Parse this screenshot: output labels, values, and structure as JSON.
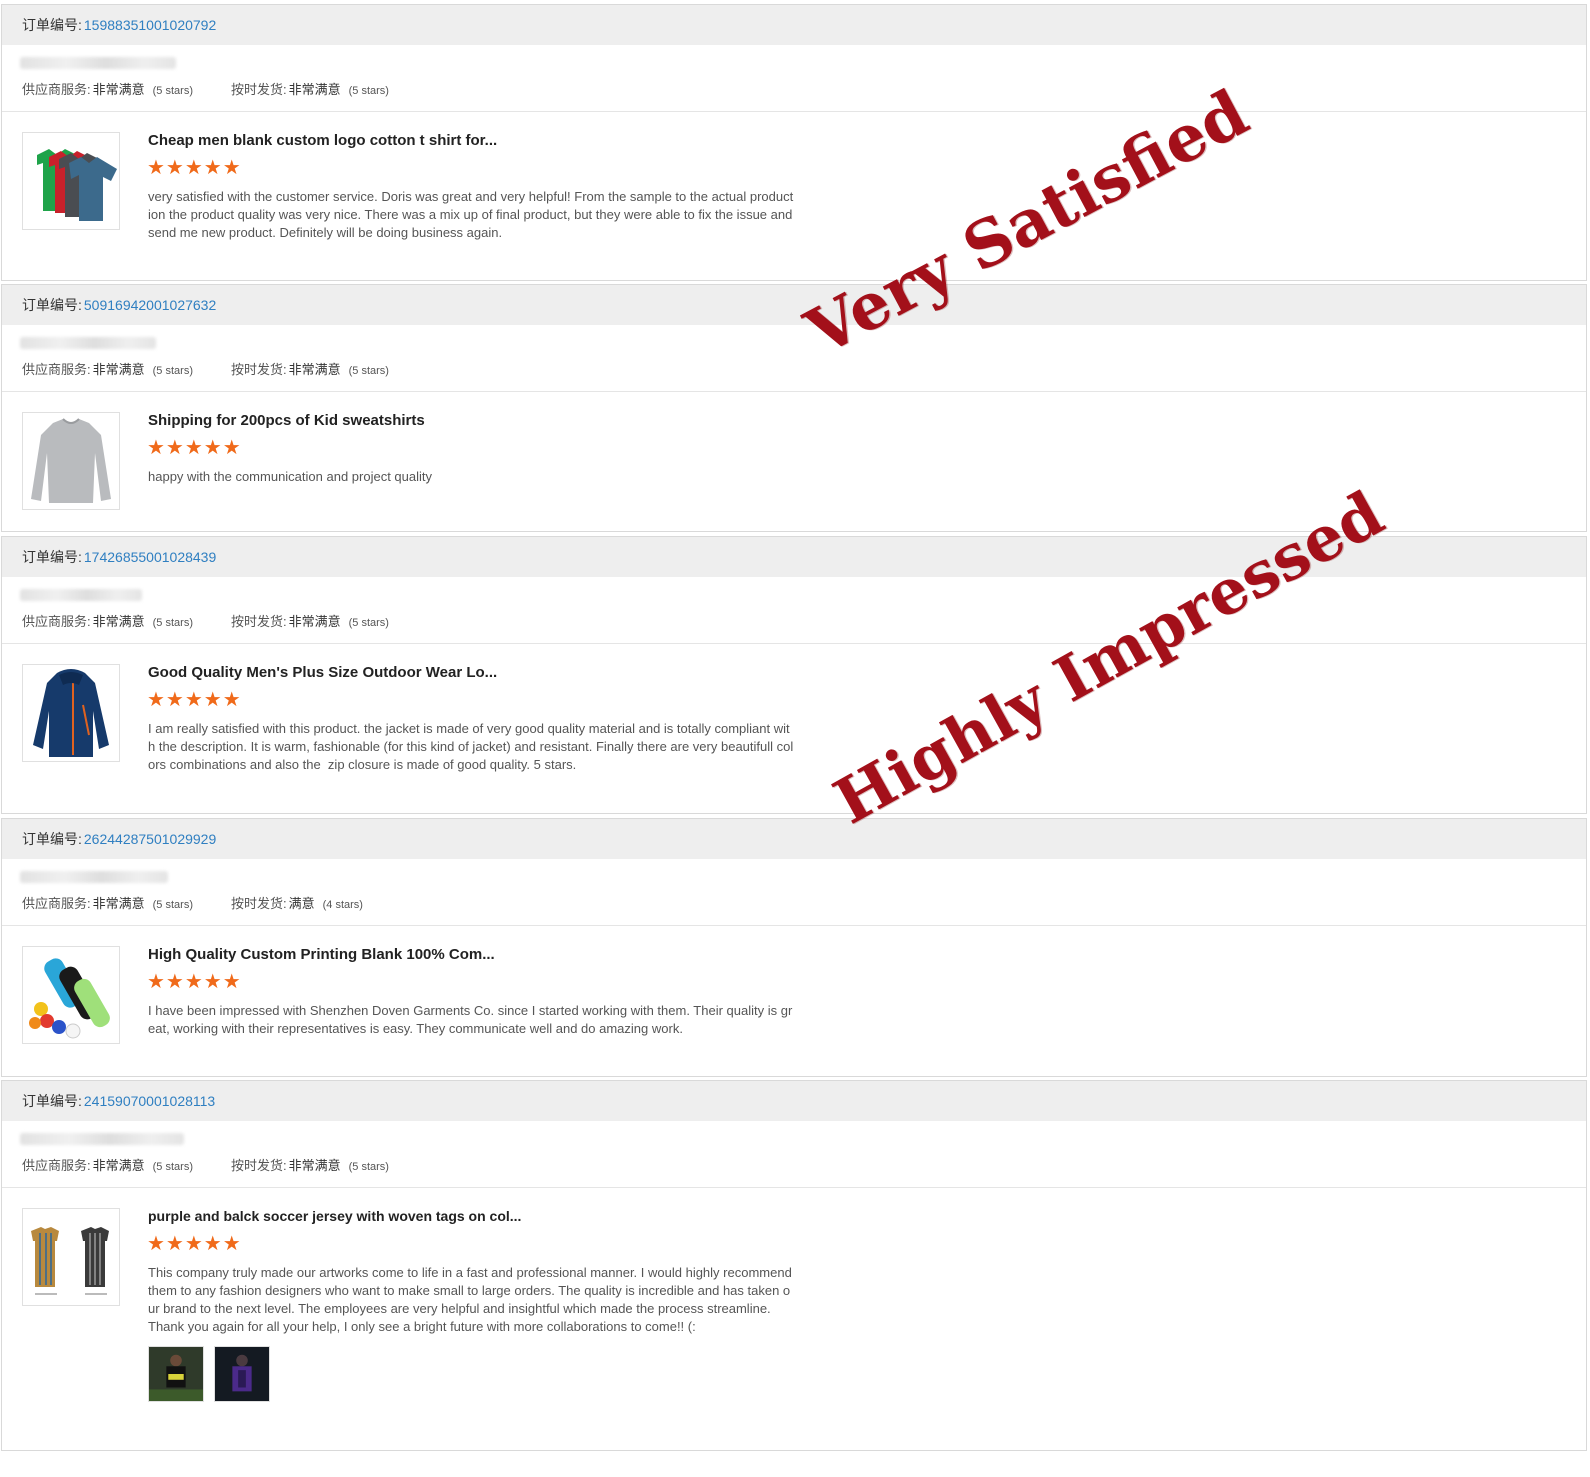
{
  "labels": {
    "order_prefix": "订单编号:",
    "supplier_service": "供应商服务:",
    "on_time_shipping": "按时发货:"
  },
  "orders": [
    {
      "order_number": "15988351001020792",
      "supplier_service_value": "非常满意",
      "supplier_service_stars": "(5 stars)",
      "shipping_value": "非常满意",
      "shipping_stars": "(5 stars)",
      "product_title": "Cheap men blank custom logo cotton t shirt for...",
      "rating": "★★★★★",
      "review": "very satisfied with the customer service. Doris was great and very helpful! From the sample to the actual production the product quality was very nice. There was a mix up of final product, but they were able to fix the issue and send me new product. Definitely will be doing business again.",
      "thumb_icon": "tshirts-icon"
    },
    {
      "order_number": "50916942001027632",
      "supplier_service_value": "非常满意",
      "supplier_service_stars": "(5 stars)",
      "shipping_value": "非常满意",
      "shipping_stars": "(5 stars)",
      "product_title": "Shipping for 200pcs of Kid sweatshirts",
      "rating": "★★★★★",
      "review": "happy with the communication and project quality",
      "thumb_icon": "sweatshirt-icon"
    },
    {
      "order_number": "17426855001028439",
      "supplier_service_value": "非常满意",
      "supplier_service_stars": "(5 stars)",
      "shipping_value": "非常满意",
      "shipping_stars": "(5 stars)",
      "product_title": "Good Quality Men's Plus Size Outdoor Wear Lo...",
      "rating": "★★★★★",
      "review": "I am really satisfied with this product. the jacket is made of very good quality material and is totally compliant with the description. It is warm, fashionable (for this kind of jacket) and resistant. Finally there are very beautifull colors combinations and also the  zip closure is made of good quality. 5 stars.",
      "thumb_icon": "jacket-icon"
    },
    {
      "order_number": "26244287501029929",
      "supplier_service_value": "非常满意",
      "supplier_service_stars": "(5 stars)",
      "shipping_value": "满意",
      "shipping_stars": "(4 stars)",
      "product_title": "High Quality Custom Printing Blank 100% Com...",
      "rating": "★★★★★",
      "review": "I have been impressed with Shenzhen Doven Garments Co. since I started working with them. Their quality is great, working with their representatives is easy. They communicate well and do amazing work.",
      "thumb_icon": "folded-shirts-icon"
    },
    {
      "order_number": "24159070001028113",
      "supplier_service_value": "非常满意",
      "supplier_service_stars": "(5 stars)",
      "shipping_value": "非常满意",
      "shipping_stars": "(5 stars)",
      "product_title": "purple and balck soccer jersey with woven tags on col...",
      "rating": "★★★★★",
      "review": "This company truly made our artworks come to life in a fast and professional manner. I would highly recommend them to any fashion designers who want to make small to large orders. The quality is incredible and has taken our brand to the next level. The employees are very helpful and insightful which made the process streamline.\nThank you again for all your help, I only see a bright future with more collaborations to come!! (:",
      "thumb_icon": "jerseys-icon"
    }
  ],
  "stamps": {
    "very_satisfied": "Very Satisfied",
    "highly_impressed": "Highly Impressed"
  },
  "colors": {
    "order_link": "#2f7fc1",
    "star": "#f06a1a",
    "stamp": "#a3101a",
    "header_bg": "#eeeeee"
  }
}
